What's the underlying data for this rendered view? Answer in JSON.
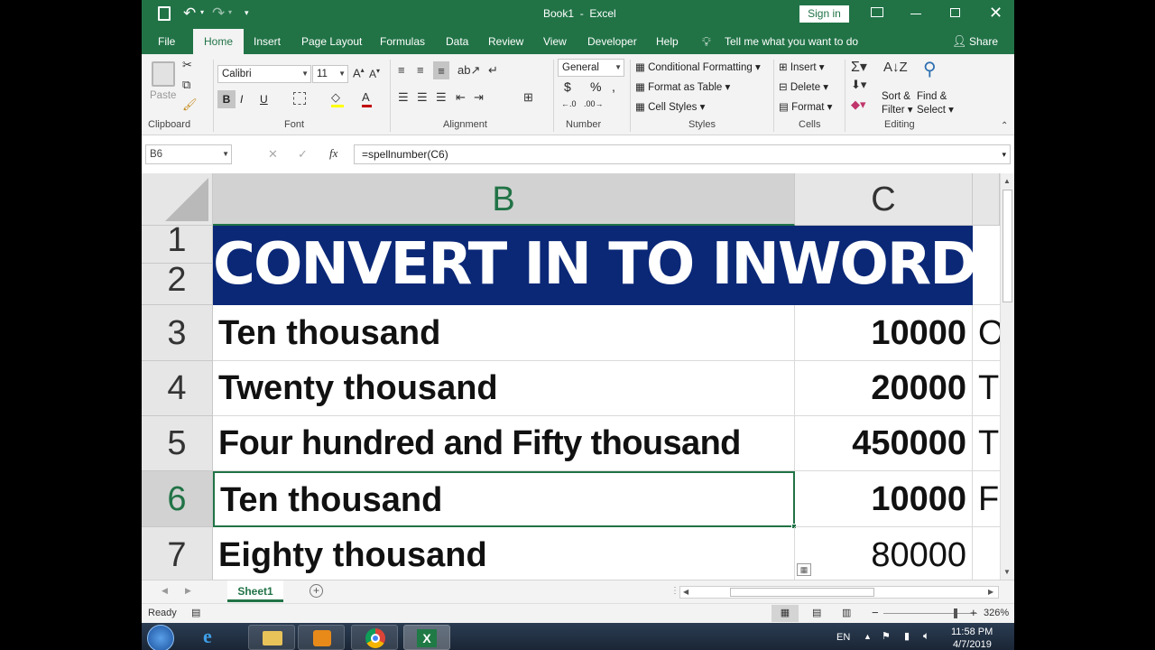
{
  "window": {
    "title": "Book1  -  Excel",
    "sign_in": "Sign in"
  },
  "ribbon_tabs": [
    "File",
    "Home",
    "Insert",
    "Page Layout",
    "Formulas",
    "Data",
    "Review",
    "View",
    "Developer",
    "Help"
  ],
  "tell_me": "Tell me what you want to do",
  "share": "Share",
  "clipboard": {
    "paste": "Paste",
    "label": "Clipboard"
  },
  "font": {
    "name": "Calibri",
    "size": "11",
    "label": "Font",
    "bold": "B",
    "italic": "I",
    "underline": "U"
  },
  "alignment": {
    "label": "Alignment"
  },
  "number": {
    "format": "General",
    "label": "Number",
    "currency": "$",
    "percent": "%"
  },
  "styles": {
    "conditional": "Conditional Formatting",
    "format_table": "Format as Table",
    "cell_styles": "Cell Styles",
    "label": "Styles"
  },
  "cells": {
    "insert": "Insert",
    "delete": "Delete",
    "format": "Format",
    "label": "Cells"
  },
  "editing": {
    "sort": "Sort &",
    "sort2": "Filter",
    "find": "Find &",
    "find2": "Select",
    "label": "Editing"
  },
  "formula_bar": {
    "name_box": "B6",
    "cancel": "✕",
    "enter": "✓",
    "fx": "fx",
    "formula": "=spellnumber(C6)"
  },
  "columns": [
    "B",
    "C"
  ],
  "banner": "CONVERT IN TO INWORD",
  "rows": [
    {
      "num": "1"
    },
    {
      "num": "2"
    },
    {
      "num": "3",
      "words": "Ten thousand",
      "value": "10000",
      "next": "O"
    },
    {
      "num": "4",
      "words": "Twenty  thousand",
      "value": "20000",
      "next": "T"
    },
    {
      "num": "5",
      "words": "Four hundred and Fifty  thousand",
      "value": "450000",
      "next": "T"
    },
    {
      "num": "6",
      "words": "Ten thousand",
      "value": "10000",
      "next": "F"
    },
    {
      "num": "7",
      "words": "Eighty  thousand",
      "value": "80000",
      "next": ""
    }
  ],
  "sheet_tab": "Sheet1",
  "status": {
    "ready": "Ready",
    "zoom": "326%"
  },
  "taskbar": {
    "lang": "EN",
    "time": "11:58 PM",
    "date": "4/7/2019"
  },
  "colors": {
    "excel_green": "#217346",
    "banner_bg": "#0b2877",
    "banner_text": "#ffffff"
  }
}
